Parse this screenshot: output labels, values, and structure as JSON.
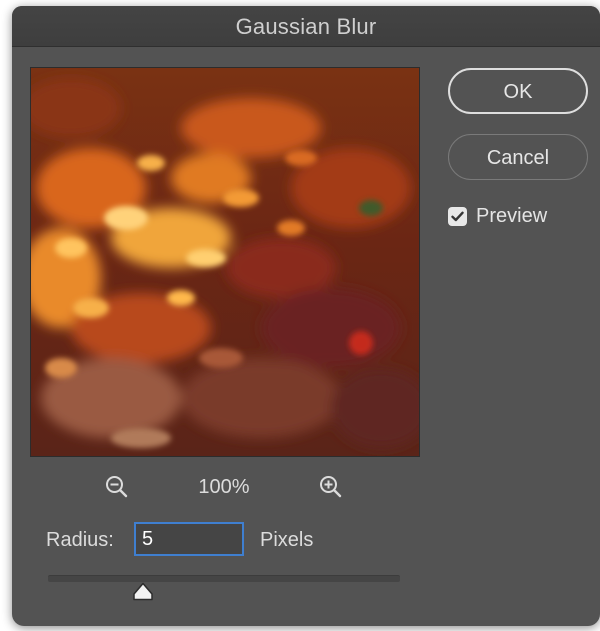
{
  "dialog": {
    "title": "Gaussian Blur"
  },
  "buttons": {
    "ok_label": "OK",
    "cancel_label": "Cancel"
  },
  "preview_option": {
    "label": "Preview",
    "checked": true
  },
  "zoom": {
    "level": "100%",
    "zoom_out_icon": "zoom-out-icon",
    "zoom_in_icon": "zoom-in-icon"
  },
  "radius": {
    "label": "Radius:",
    "value": "5",
    "units": "Pixels",
    "slider_fraction": 0.27
  },
  "colors": {
    "dialog_bg": "#535353",
    "titlebar_bg": "#424242",
    "input_focus": "#3f7fd0",
    "checkbox_fill": "#e8e8e8"
  }
}
